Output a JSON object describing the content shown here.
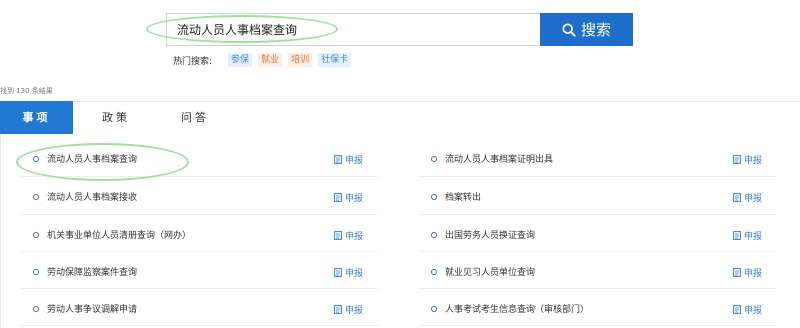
{
  "search": {
    "value": "流动人员人事档案查询",
    "button_label": "搜索"
  },
  "hot_search": {
    "label": "热门搜索:",
    "tags": [
      {
        "label": "参保",
        "color": "#3d86d6"
      },
      {
        "label": "就业",
        "color": "#e6723a"
      },
      {
        "label": "培训",
        "color": "#e6723a"
      },
      {
        "label": "社保卡",
        "color": "#3d86d6"
      }
    ]
  },
  "result_count": "找到  130  条结果",
  "tabs": [
    {
      "label": "事项",
      "active": true
    },
    {
      "label": "政策",
      "active": false
    },
    {
      "label": "问答",
      "active": false
    }
  ],
  "apply_label": "申报",
  "items_left": [
    "流动人员人事档案查询",
    "流动人员人事档案接收",
    "机关事业单位人员清册查询（网办）",
    "劳动保障监察案件查询",
    "劳动人事争议调解申请"
  ],
  "items_right": [
    "流动人员人事档案证明出具",
    "档案转出",
    "出国劳务人员换证查询",
    "就业见习人员单位查询",
    "人事考试考生信息查询（审核部门）"
  ],
  "colors": {
    "accent": "#2279d2",
    "search_button": "#1e6fc9",
    "highlight": "#9fe09a"
  }
}
